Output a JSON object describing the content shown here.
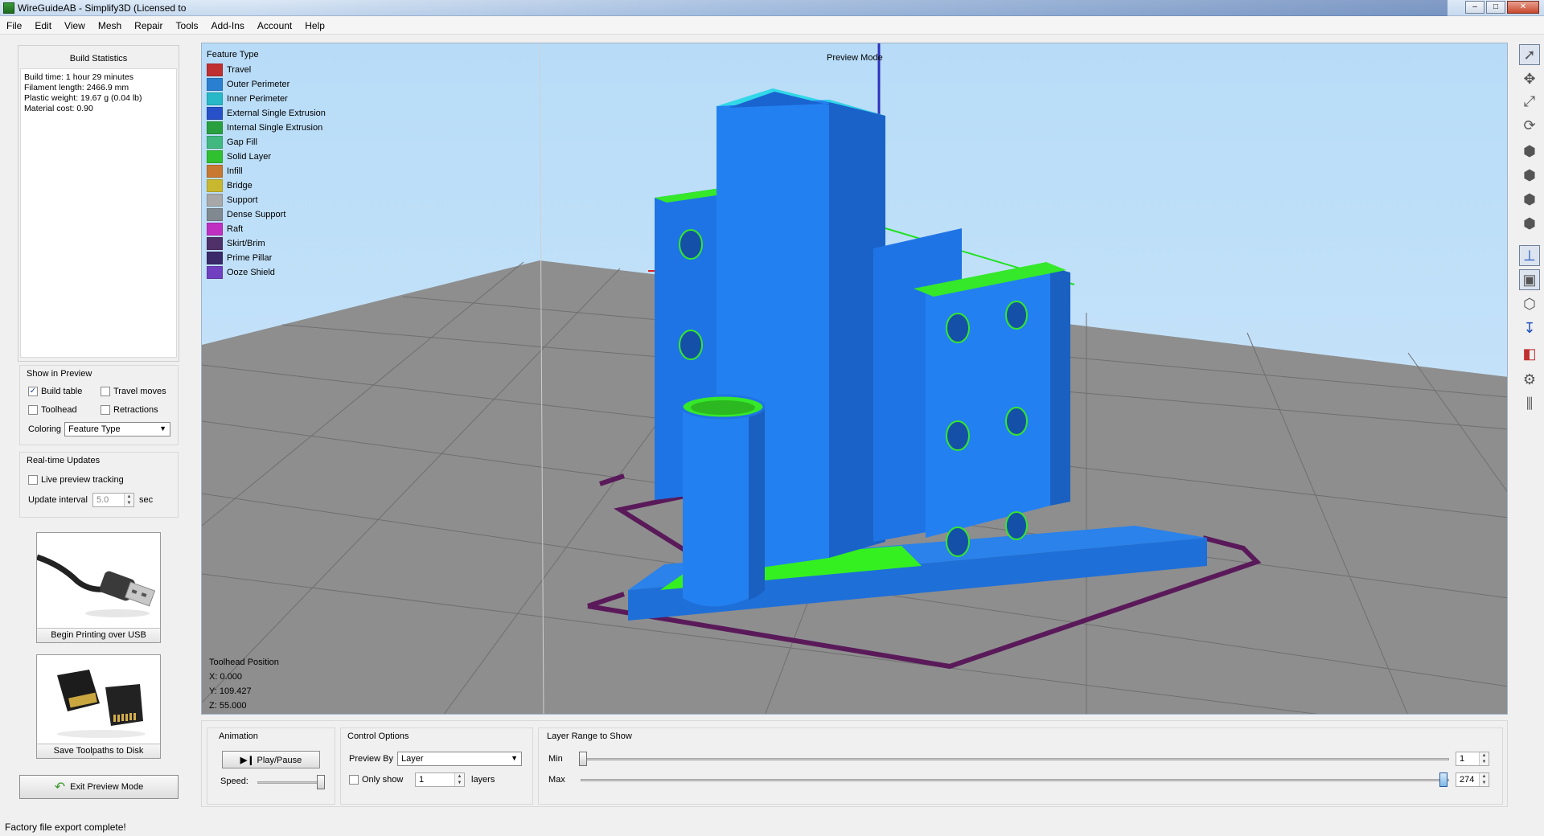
{
  "window": {
    "title": "WireGuideAB - Simplify3D (Licensed to"
  },
  "menu": [
    "File",
    "Edit",
    "View",
    "Mesh",
    "Repair",
    "Tools",
    "Add-Ins",
    "Account",
    "Help"
  ],
  "build_stats": {
    "title": "Build Statistics",
    "lines": [
      "Build time: 1 hour 29 minutes",
      "Filament length: 2466.9 mm",
      "Plastic weight: 19.67 g (0.04 lb)",
      "Material cost: 0.90"
    ]
  },
  "show_in_preview": {
    "title": "Show in Preview",
    "build_table": "Build table",
    "travel_moves": "Travel moves",
    "toolhead": "Toolhead",
    "retractions": "Retractions",
    "build_table_checked": true,
    "coloring_label": "Coloring",
    "coloring_value": "Feature Type"
  },
  "realtime": {
    "title": "Real-time Updates",
    "live_tracking": "Live preview tracking",
    "interval_label": "Update interval",
    "interval_value": "5.0",
    "interval_unit": "sec"
  },
  "buttons": {
    "usb": "Begin Printing over USB",
    "save": "Save Toolpaths to Disk",
    "exit": "Exit Preview Mode"
  },
  "viewport": {
    "preview_mode": "Preview Mode",
    "legend_title": "Feature Type",
    "legend": [
      {
        "label": "Travel",
        "color": "#c03030"
      },
      {
        "label": "Outer Perimeter",
        "color": "#2a7fd0"
      },
      {
        "label": "Inner Perimeter",
        "color": "#28b8c8"
      },
      {
        "label": "External Single Extrusion",
        "color": "#2850c8"
      },
      {
        "label": "Internal Single Extrusion",
        "color": "#28a040"
      },
      {
        "label": "Gap Fill",
        "color": "#40b880"
      },
      {
        "label": "Solid Layer",
        "color": "#30c030"
      },
      {
        "label": "Infill",
        "color": "#c87830"
      },
      {
        "label": "Bridge",
        "color": "#c8b830"
      },
      {
        "label": "Support",
        "color": "#a8a8a8"
      },
      {
        "label": "Dense Support",
        "color": "#808890"
      },
      {
        "label": "Raft",
        "color": "#c030c0"
      },
      {
        "label": "Skirt/Brim",
        "color": "#503068"
      },
      {
        "label": "Prime Pillar",
        "color": "#3a2a6a"
      },
      {
        "label": "Ooze Shield",
        "color": "#7040c0"
      }
    ],
    "toolhead_title": "Toolhead Position",
    "x": "X: 0.000",
    "y": "Y: 109.427",
    "z": "Z: 55.000"
  },
  "animation": {
    "title": "Animation",
    "play": "Play/Pause",
    "speed": "Speed:"
  },
  "control": {
    "title": "Control Options",
    "preview_by": "Preview By",
    "preview_value": "Layer",
    "only_show": "Only show",
    "only_value": "1",
    "layers": "layers"
  },
  "layer_range": {
    "title": "Layer Range to Show",
    "min_label": "Min",
    "max_label": "Max",
    "min_value": "1",
    "max_value": "274"
  },
  "status": "Factory file export complete!"
}
